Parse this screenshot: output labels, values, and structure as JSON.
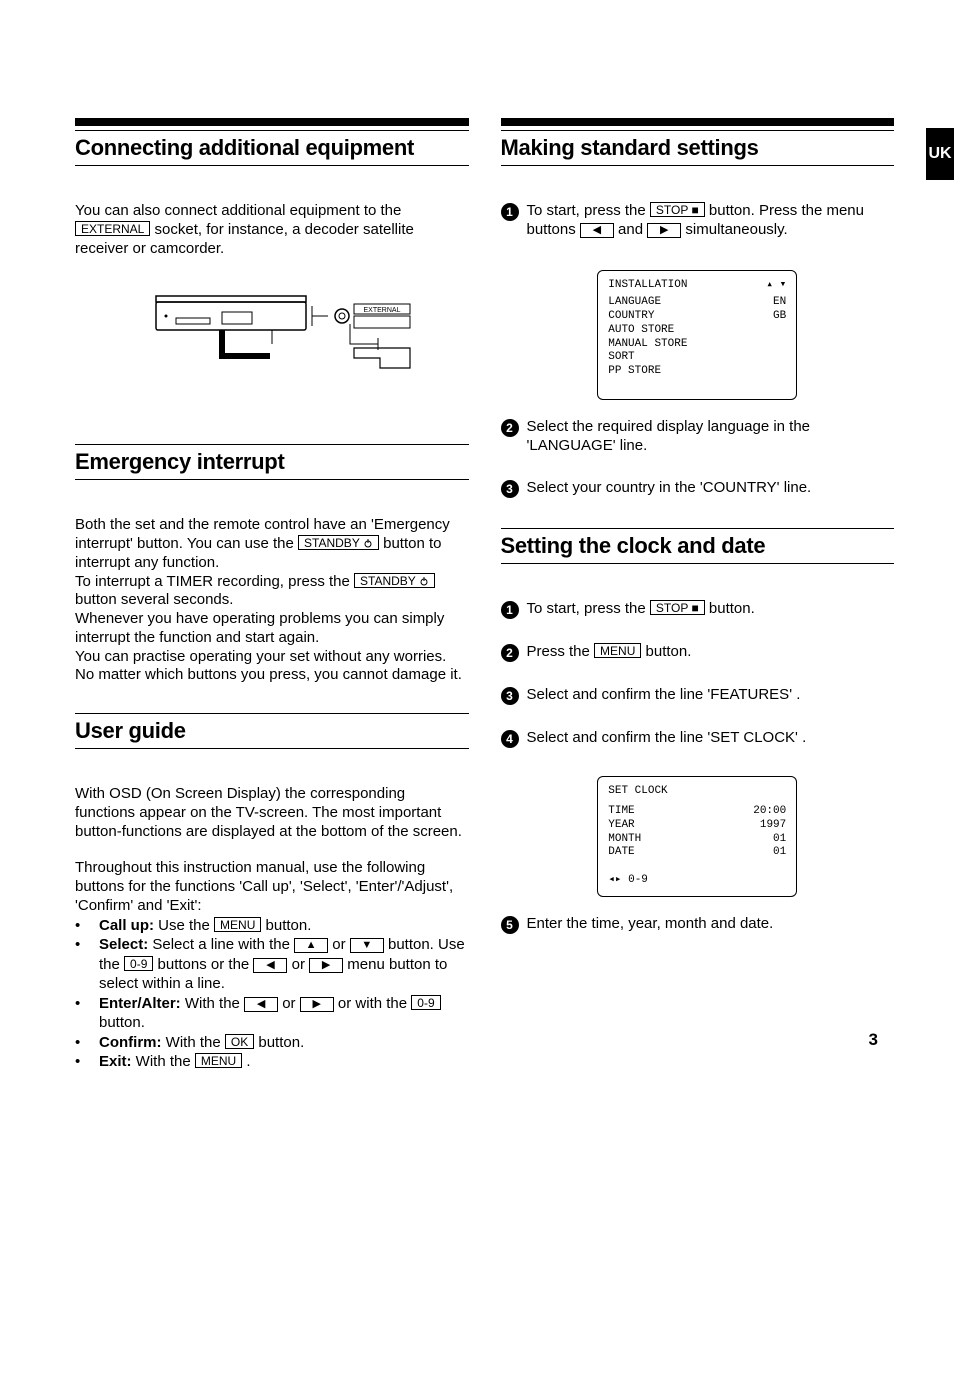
{
  "page_number": "3",
  "tab_label": "UK",
  "left": {
    "sec1": {
      "title": "Connecting additional equipment",
      "text_a": "You can also connect additional equipment to the ",
      "ext_label": "EXTERNAL",
      "text_b": " socket, for instance, a decoder satellite receiver or camcorder."
    },
    "sec2": {
      "title": "Emergency interrupt",
      "p1_a": "Both the set and the remote control have an 'Emergency interrupt' button. You can use the ",
      "standby_label": "STANDBY",
      "p1_b": " button to interrupt any function.",
      "p2_a": "To interrupt a TIMER recording, press the ",
      "p2_b": " button several seconds.",
      "p3": "Whenever you have operating problems you can simply interrupt the function and start again.",
      "p4": "You can practise operating your set without any worries. No matter which buttons you press, you cannot damage it."
    },
    "sec3": {
      "title": "User guide",
      "p1": "With OSD (On Screen Display) the corresponding functions appear on the TV-screen. The most important button-functions are displayed at the bottom of the screen.",
      "p2": "Throughout this instruction manual, use the following buttons for the functions 'Call up', 'Select', 'Enter'/'Adjust', 'Confirm' and 'Exit':",
      "bullets": {
        "callup_a": "Call up:",
        "callup_b": " Use the ",
        "menu_label": "MENU",
        "callup_c": " button.",
        "select_a": "Select:",
        "select_b": " Select a line with the ",
        "select_or": " or ",
        "select_c": " button. Use the ",
        "num_label": "0-9",
        "select_d": " buttons or the ",
        "select_e": " menu button to select within a line.",
        "enter_a": "Enter/Alter:",
        "enter_b": " With the ",
        "enter_or": " or ",
        "enter_c": " or with the ",
        "enter_d": " button.",
        "confirm_a": "Confirm:",
        "confirm_b": " With the ",
        "ok_label": "OK",
        "confirm_c": " button.",
        "exit_a": "Exit:",
        "exit_b": " With the ",
        "exit_c": " ."
      }
    }
  },
  "right": {
    "sec1": {
      "title": "Making standard settings",
      "step1_a": "To start, press the ",
      "stop_label": "STOP",
      "step1_b": " button. Press the menu buttons ",
      "step1_and": " and ",
      "step1_c": " simultaneously.",
      "osd": {
        "title": "INSTALLATION",
        "lang": "LANGUAGE",
        "lang_v": "EN",
        "country": "COUNTRY",
        "country_v": "GB",
        "auto": "AUTO STORE",
        "manual": "MANUAL STORE",
        "sort": "SORT",
        "pp": "PP STORE"
      },
      "step2": "Select the required display language in the 'LANGUAGE' line.",
      "step3": "Select your country in the 'COUNTRY' line."
    },
    "sec2": {
      "title": "Setting the clock and date",
      "step1_a": "To start, press the ",
      "step1_b": " button.",
      "step2_a": "Press the ",
      "menu_label": "MENU",
      "step2_b": " button.",
      "step3": "Select and confirm the line 'FEATURES' .",
      "step4": "Select and confirm the line 'SET CLOCK' .",
      "osd": {
        "title": "SET CLOCK",
        "time": "TIME",
        "time_v": "20:00",
        "year": "YEAR",
        "year_v": "1997",
        "month": "MONTH",
        "month_v": "01",
        "date": "DATE",
        "date_v": "01",
        "hint": "◂▸  0-9"
      },
      "step5": "Enter the time, year, month and date."
    }
  }
}
